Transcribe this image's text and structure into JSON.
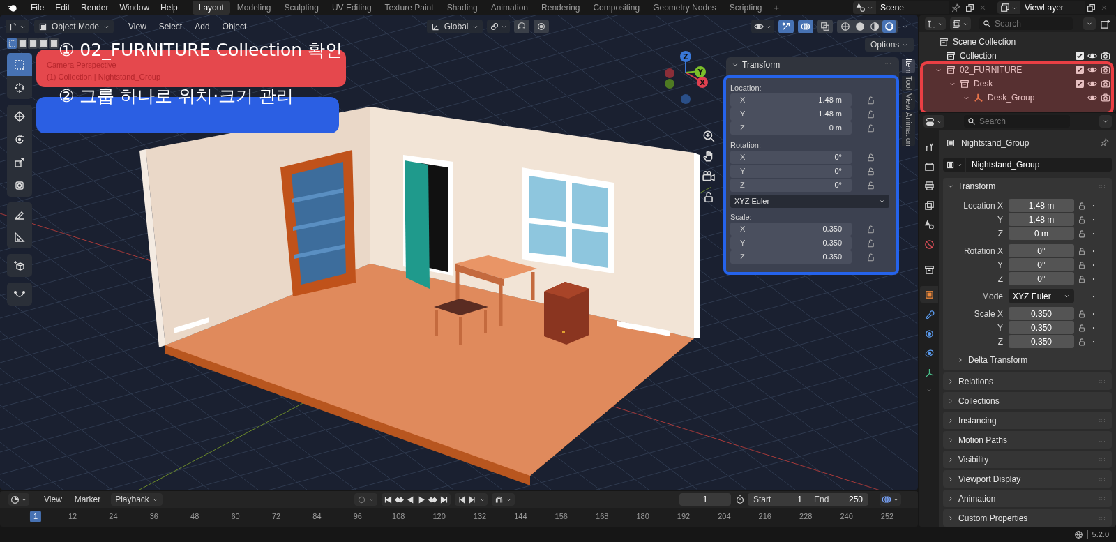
{
  "top_menu": [
    "File",
    "Edit",
    "Render",
    "Window",
    "Help"
  ],
  "workspaces": [
    {
      "label": "Layout",
      "selected": true
    },
    {
      "label": "Modeling",
      "selected": false
    },
    {
      "label": "Sculpting",
      "selected": false
    },
    {
      "label": "UV Editing",
      "selected": false
    },
    {
      "label": "Texture Paint",
      "selected": false
    },
    {
      "label": "Shading",
      "selected": false
    },
    {
      "label": "Animation",
      "selected": false
    },
    {
      "label": "Rendering",
      "selected": false
    },
    {
      "label": "Compositing",
      "selected": false
    },
    {
      "label": "Geometry Nodes",
      "selected": false
    },
    {
      "label": "Scripting",
      "selected": false
    }
  ],
  "add_workspace": "+",
  "scene": {
    "name": "Scene"
  },
  "view_layer": {
    "name": "ViewLayer"
  },
  "viewport": {
    "mode": "Object Mode",
    "menus": [
      "View",
      "Select",
      "Add",
      "Object"
    ],
    "orientation": "Global",
    "toggles": [
      {
        "kind": "snap",
        "on": false
      },
      {
        "kind": "proportional",
        "on": false
      },
      {
        "kind": "gizmos",
        "on": true
      },
      {
        "kind": "overlays",
        "on": true
      },
      {
        "kind": "xray",
        "on": false
      }
    ],
    "shading": [
      {
        "kind": "wireframe",
        "selected": false
      },
      {
        "kind": "solid",
        "selected": false
      },
      {
        "kind": "material",
        "selected": false
      },
      {
        "kind": "rendered",
        "selected": true
      }
    ],
    "options": "Options",
    "info": [
      "Camera Perspective",
      "(1) Collection | Nightstand_Group"
    ],
    "tools": [
      {
        "kind": "select",
        "selected": true
      },
      {
        "kind": "cursor",
        "selected": false
      },
      {
        "kind": "move",
        "selected": false
      },
      {
        "kind": "rotate",
        "selected": false
      },
      {
        "kind": "scale",
        "selected": false
      },
      {
        "kind": "transform",
        "selected": false
      },
      {
        "kind": "annotate",
        "selected": false
      },
      {
        "kind": "measure",
        "selected": false
      },
      {
        "kind": "add_cube",
        "selected": false
      },
      {
        "kind": "curve",
        "selected": false
      }
    ],
    "gizmo_axes": [
      "Z",
      "Y",
      "X"
    ]
  },
  "annotations": [
    {
      "text": "① 02_FURNITURE Collection 확인",
      "color": "#e5484d"
    },
    {
      "text": "② 그룹 하나로 위치·크기 관리",
      "color": "#2b5fe3"
    }
  ],
  "n_panel": {
    "title": "Transform",
    "location": {
      "label": "Location:",
      "fields": [
        {
          "axis": "X",
          "value": "1.48 m"
        },
        {
          "axis": "Y",
          "value": "1.48 m"
        },
        {
          "axis": "Z",
          "value": "0 m"
        }
      ]
    },
    "rotation": {
      "label": "Rotation:",
      "fields": [
        {
          "axis": "X",
          "value": "0°"
        },
        {
          "axis": "Y",
          "value": "0°"
        },
        {
          "axis": "Z",
          "value": "0°"
        }
      ]
    },
    "rotation_mode": "XYZ Euler",
    "scale": {
      "label": "Scale:",
      "fields": [
        {
          "axis": "X",
          "value": "0.350"
        },
        {
          "axis": "Y",
          "value": "0.350"
        },
        {
          "axis": "Z",
          "value": "0.350"
        }
      ]
    }
  },
  "sidebar_tabs": [
    {
      "label": "Item",
      "selected": true
    },
    {
      "label": "Tool",
      "selected": false
    },
    {
      "label": "View",
      "selected": false
    },
    {
      "label": "Animation",
      "selected": false
    }
  ],
  "outliner": {
    "search": {
      "placeholder": "Search"
    },
    "tree": [
      {
        "label": "Scene Collection",
        "kind": "scene",
        "children": [
          {
            "label": "Collection",
            "kind": "collection",
            "checked": true
          },
          {
            "label": "02_FURNITURE",
            "kind": "collection",
            "checked": true,
            "expanded": true,
            "children": [
              {
                "label": "Desk",
                "kind": "collection",
                "checked": true,
                "expanded": true,
                "children": [
                  {
                    "label": "Desk_Group",
                    "kind": "empty",
                    "expanded": true
                  }
                ]
              }
            ]
          }
        ]
      }
    ]
  },
  "properties": {
    "search": {
      "placeholder": "Search"
    },
    "tabs": [
      {
        "kind": "tool",
        "selected": false
      },
      {
        "kind": "render",
        "selected": false
      },
      {
        "kind": "output",
        "selected": false
      },
      {
        "kind": "view_layer",
        "selected": false
      },
      {
        "kind": "scene",
        "selected": false
      },
      {
        "kind": "world",
        "selected": false
      },
      {
        "kind": "collection",
        "selected": false
      },
      {
        "kind": "object",
        "selected": true
      },
      {
        "kind": "modifiers",
        "selected": false
      },
      {
        "kind": "particles",
        "selected": false
      },
      {
        "kind": "physics",
        "selected": false
      },
      {
        "kind": "data",
        "selected": false
      }
    ],
    "object_name": "Nightstand_Group",
    "datablock": "Nightstand_Group",
    "transform": {
      "title": "Transform",
      "expanded": true,
      "groups": [
        {
          "rows": [
            {
              "label": "Location X",
              "value": "1.48 m",
              "kind": "field"
            },
            {
              "label": "Y",
              "value": "1.48 m",
              "kind": "field"
            },
            {
              "label": "Z",
              "value": "0 m",
              "kind": "field"
            }
          ]
        },
        {
          "rows": [
            {
              "label": "Rotation X",
              "value": "0°",
              "kind": "field"
            },
            {
              "label": "Y",
              "value": "0°",
              "kind": "field"
            },
            {
              "label": "Z",
              "value": "0°",
              "kind": "field"
            }
          ]
        },
        {
          "rows": [
            {
              "label": "Mode",
              "value": "XYZ Euler",
              "kind": "dropdown"
            }
          ]
        },
        {
          "rows": [
            {
              "label": "Scale X",
              "value": "0.350",
              "kind": "field"
            },
            {
              "label": "Y",
              "value": "0.350",
              "kind": "field"
            },
            {
              "label": "Z",
              "value": "0.350",
              "kind": "field"
            }
          ]
        }
      ],
      "subpanel": {
        "label": "Delta Transform",
        "expanded": false
      }
    },
    "panels": [
      {
        "label": "Relations",
        "expanded": false
      },
      {
        "label": "Collections",
        "expanded": false
      },
      {
        "label": "Instancing",
        "expanded": false
      },
      {
        "label": "Motion Paths",
        "expanded": false
      },
      {
        "label": "Visibility",
        "expanded": false
      },
      {
        "label": "Viewport Display",
        "expanded": false
      },
      {
        "label": "Animation",
        "expanded": false
      },
      {
        "label": "Custom Properties",
        "expanded": false
      }
    ]
  },
  "timeline": {
    "menus": [
      "View",
      "Marker"
    ],
    "playback": "Playback",
    "current_frame": "1",
    "start_label": "Start",
    "start": "1",
    "end_label": "End",
    "end": "250",
    "ruler": [
      {
        "label": "1",
        "selected": true
      },
      {
        "label": "12",
        "selected": false
      },
      {
        "label": "24",
        "selected": false
      },
      {
        "label": "36",
        "selected": false
      },
      {
        "label": "48",
        "selected": false
      },
      {
        "label": "60",
        "selected": false
      },
      {
        "label": "72",
        "selected": false
      },
      {
        "label": "84",
        "selected": false
      },
      {
        "label": "96",
        "selected": false
      },
      {
        "label": "108",
        "selected": false
      },
      {
        "label": "120",
        "selected": false
      },
      {
        "label": "132",
        "selected": false
      },
      {
        "label": "144",
        "selected": false
      },
      {
        "label": "156",
        "selected": false
      },
      {
        "label": "168",
        "selected": false
      },
      {
        "label": "180",
        "selected": false
      },
      {
        "label": "192",
        "selected": false
      },
      {
        "label": "204",
        "selected": false
      },
      {
        "label": "216",
        "selected": false
      },
      {
        "label": "228",
        "selected": false
      },
      {
        "label": "240",
        "selected": false
      },
      {
        "label": "252",
        "selected": false
      }
    ]
  },
  "status_bar": {
    "version": "5.2.0"
  }
}
